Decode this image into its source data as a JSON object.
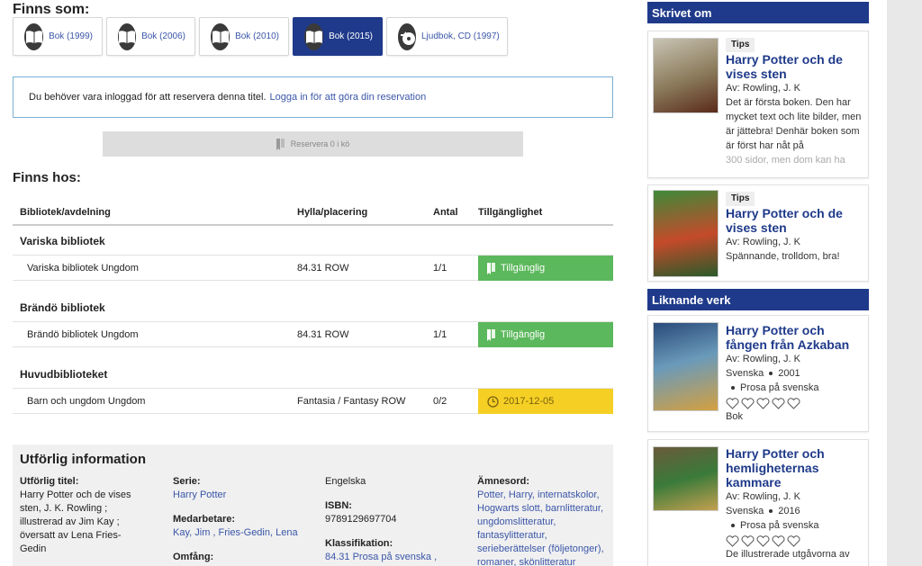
{
  "formats": {
    "heading": "Finns som:",
    "items": [
      {
        "label": "Bok (1999)",
        "icon": "book-icon"
      },
      {
        "label": "Bok (2006)",
        "icon": "book-icon"
      },
      {
        "label": "Bok (2010)",
        "icon": "book-icon"
      },
      {
        "label": "Bok (2015)",
        "icon": "book-icon",
        "active": true
      },
      {
        "label": "Ljudbok, CD (1997)",
        "icon": "audio-cd-icon"
      }
    ]
  },
  "notice": {
    "text": "Du behöver vara inloggad för att reservera denna titel.",
    "link": "Logga in för att göra din reservation"
  },
  "reserve": {
    "label": "Reservera 0 i kö"
  },
  "holdings": {
    "heading": "Finns hos:",
    "columns": [
      "Bibliotek/avdelning",
      "Hylla/placering",
      "Antal",
      "Tillgänglighet"
    ],
    "groups": [
      {
        "library": "Variska bibliotek",
        "row": {
          "dept": "Variska bibliotek Ungdom",
          "shelf": "84.31 ROW",
          "count": "1/1",
          "status": "Tillgänglig"
        }
      },
      {
        "library": "Brändö bibliotek",
        "row": {
          "dept": "Brändö bibliotek Ungdom",
          "shelf": "84.31 ROW",
          "count": "1/1",
          "status": "Tillgänglig"
        }
      },
      {
        "library": "Huvudbiblioteket",
        "row": {
          "dept": "Barn och ungdom Ungdom",
          "shelf": "Fantasia / Fantasy ROW",
          "count": "0/2",
          "status": "2017-12-05"
        }
      }
    ]
  },
  "info": {
    "heading": "Utförlig information",
    "title_key": "Utförlig titel:",
    "title_lines": [
      "Harry Potter och de vises",
      "sten, J. K. Rowling ;",
      "illustrerad av Jim Kay ;",
      "översatt av Lena Fries-",
      "Gedin"
    ],
    "serie_key": "Serie:",
    "serie_val": "Harry Potter",
    "medarb_key": "Medarbetare:",
    "medarb_val": "Kay, Jim , Fries-Gedin, Lena",
    "omfang_key": "Omfång:",
    "language": "Engelska",
    "isbn_key": "ISBN:",
    "isbn_val": "9789129697704",
    "klass_key": "Klassifikation:",
    "klass_val": "84.31 Prosa på svenska ,",
    "amnes_key": "Ämnesord:",
    "amnes_lines": [
      "Potter, Harry, internatskolor,",
      "Hogwarts slott, barnlitteratur,",
      "ungdomslitteratur,",
      "fantasylitteratur,",
      "serieberättelser (följetonger),",
      "romaner, skönlitteratur"
    ]
  },
  "sidebar": {
    "skrivet_heading": "Skrivet om",
    "reviews": [
      {
        "tag": "Tips",
        "title": "Harry Potter och de vises sten",
        "by": "Av: Rowling, J. K",
        "desc": "Det är första boken. Den har mycket text och lite bilder, men är jättebra! Denhär boken som är först har nåt på",
        "desc_fade": "300 sidor, men dom kan ha"
      },
      {
        "tag": "Tips",
        "title": "Harry Potter och de vises sten",
        "by": "Av: Rowling, J. K",
        "desc": "Spännande, trolldom, bra!"
      }
    ],
    "liknande_heading": "Liknande verk",
    "similar": [
      {
        "title": "Harry Potter och fången från Azkaban",
        "by": "Av: Rowling, J. K",
        "lang": "Svenska",
        "year": "2001",
        "genre": "Prosa på svenska",
        "type": "Bok"
      },
      {
        "title": "Harry Potter och hemligheternas kammare",
        "by": "Av: Rowling, J. K",
        "lang": "Svenska",
        "year": "2016",
        "genre": "Prosa på svenska",
        "extra": "De illustrerade utgåvorna av"
      }
    ]
  },
  "colors": {
    "brand": "#1f3a8a",
    "available": "#5cb85c",
    "due": "#f5cf24",
    "link": "#3a56a8"
  }
}
